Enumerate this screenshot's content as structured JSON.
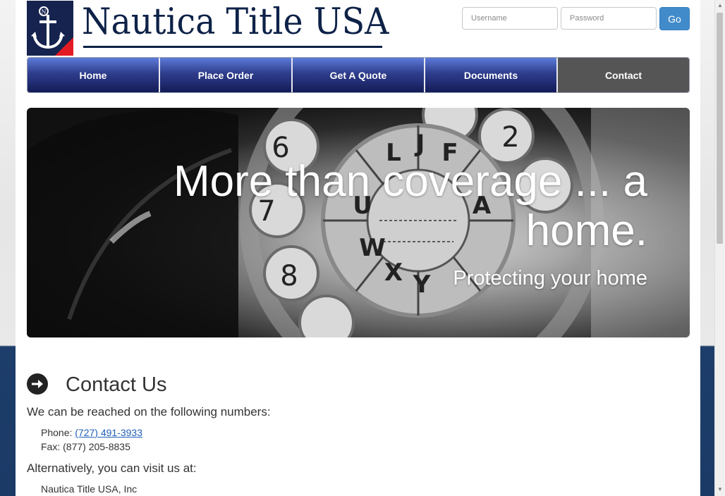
{
  "brand": {
    "name": "Nautica Title USA",
    "logo_letter": "N"
  },
  "login": {
    "username_placeholder": "Username",
    "password_placeholder": "Password",
    "go_label": "Go",
    "go_color": "#428bca"
  },
  "nav": {
    "items": [
      "Home",
      "Place Order",
      "Get A Quote",
      "Documents",
      "Contact"
    ],
    "active": "Contact"
  },
  "hero": {
    "headline": "More than coverage ... a home.",
    "subheadline": "Protecting your home"
  },
  "contact": {
    "title": "Contact Us",
    "intro": "We can be reached on the following numbers:",
    "phone_label": "Phone:",
    "phone_number": "(727) 491-3933",
    "fax_label": "Fax:",
    "fax_number": "(877) 205-8835",
    "visit_intro": "Alternatively, you can visit us at:",
    "address_line1": "Nautica Title USA, Inc"
  },
  "colors": {
    "brand_navy": "#0e2248",
    "nav_active": "#555555",
    "link": "#1f5fb8"
  }
}
